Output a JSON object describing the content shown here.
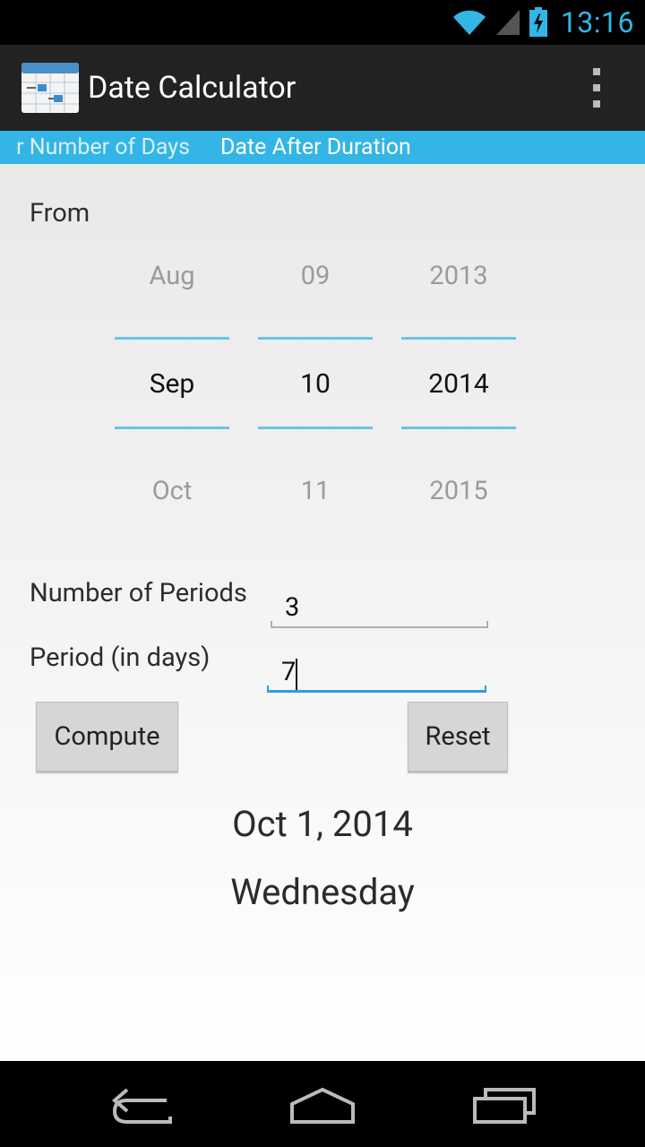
{
  "status": {
    "time": "13:16"
  },
  "app": {
    "title": "Date Calculator"
  },
  "tabs": [
    {
      "label": "r Number of Days",
      "state": "adjacent"
    },
    {
      "label": "Date After Duration",
      "state": "selected"
    }
  ],
  "from": {
    "label": "From",
    "month": {
      "prev": "Aug",
      "selected": "Sep",
      "next": "Oct"
    },
    "day": {
      "prev": "09",
      "selected": "10",
      "next": "11"
    },
    "year": {
      "prev": "2013",
      "selected": "2014",
      "next": "2015"
    }
  },
  "periods": {
    "label": "Number of Periods",
    "value": "3"
  },
  "period_days": {
    "label": "Period (in days)",
    "value": "7"
  },
  "buttons": {
    "compute": "Compute",
    "reset": "Reset"
  },
  "result": {
    "date": "Oct 1, 2014",
    "weekday": "Wednesday"
  },
  "colors": {
    "accent": "#33b5e5",
    "actionbar": "#222222"
  }
}
